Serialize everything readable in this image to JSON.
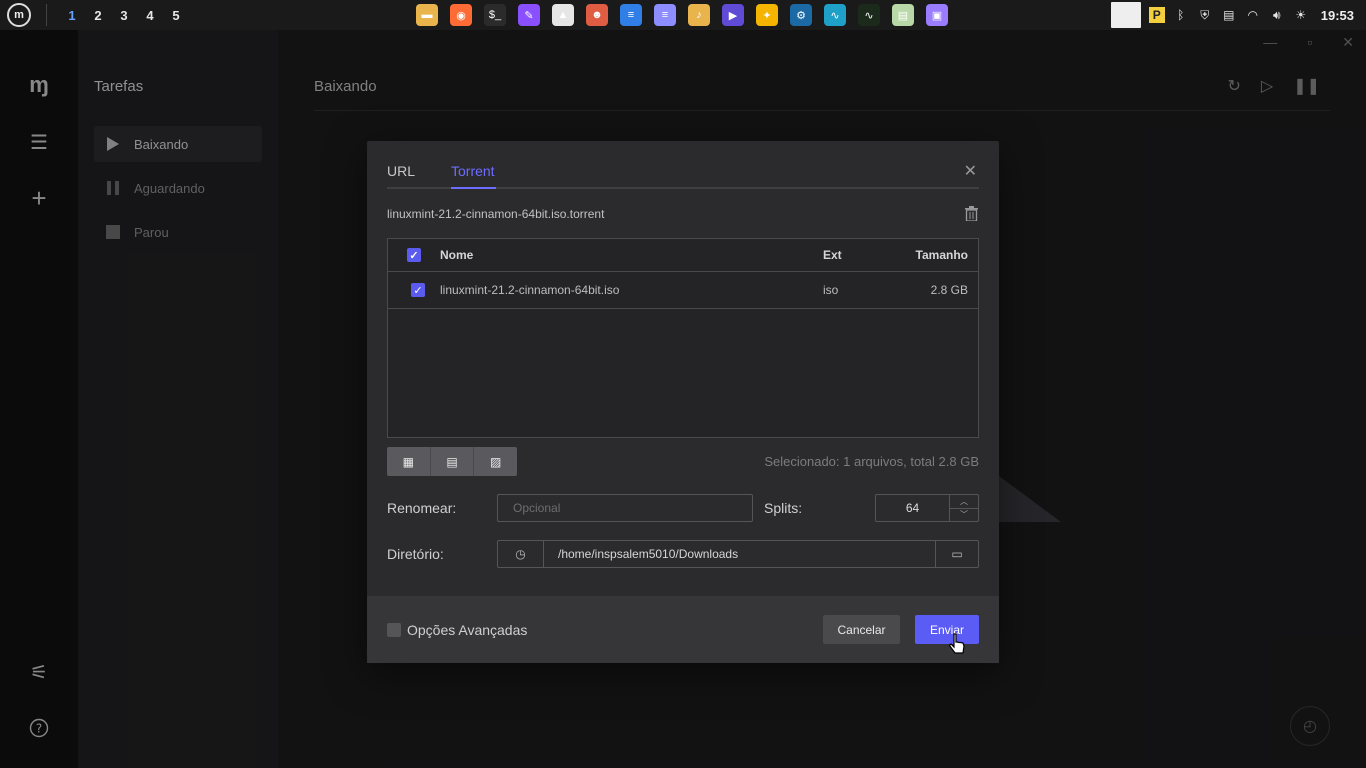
{
  "panel": {
    "workspaces": [
      "1",
      "2",
      "3",
      "4",
      "5"
    ],
    "active_workspace": "1",
    "clock": "19:53",
    "launchers": [
      {
        "name": "files",
        "glyph": "▬",
        "color": "#e9b44c"
      },
      {
        "name": "firefox",
        "glyph": "◉",
        "color": "#ff6b35"
      },
      {
        "name": "terminal",
        "glyph": "$_",
        "color": "#2b2b2b"
      },
      {
        "name": "paint",
        "glyph": "✎",
        "color": "#8a4fff"
      },
      {
        "name": "inkscape",
        "glyph": "▲",
        "color": "#e6e6e6"
      },
      {
        "name": "gimp",
        "glyph": "☻",
        "color": "#e05d44"
      },
      {
        "name": "writer",
        "glyph": "≡",
        "color": "#2f7fe6"
      },
      {
        "name": "text-editor",
        "glyph": "≡",
        "color": "#8d8dff"
      },
      {
        "name": "music-folder",
        "glyph": "♪",
        "color": "#e9b44c"
      },
      {
        "name": "media-player",
        "glyph": "▶",
        "color": "#5f4bd6"
      },
      {
        "name": "game",
        "glyph": "✦",
        "color": "#f5b400"
      },
      {
        "name": "steam",
        "glyph": "⚙",
        "color": "#1b6aa6"
      },
      {
        "name": "monitor",
        "glyph": "∿",
        "color": "#1fa0c9"
      },
      {
        "name": "system-monitor",
        "glyph": "∿",
        "color": "#1c2a1c"
      },
      {
        "name": "settings",
        "glyph": "▤",
        "color": "#b8d8a8"
      },
      {
        "name": "drive",
        "glyph": "▣",
        "color": "#9a7cff"
      }
    ]
  },
  "sidebar": {
    "title": "Tarefas",
    "items": [
      {
        "label": "Baixando",
        "active": true
      },
      {
        "label": "Aguardando",
        "active": false
      },
      {
        "label": "Parou",
        "active": false
      }
    ]
  },
  "main": {
    "title": "Baixando"
  },
  "dialog": {
    "tabs": [
      {
        "label": "URL",
        "active": false
      },
      {
        "label": "Torrent",
        "active": true
      }
    ],
    "torrent_file": "linuxmint-21.2-cinnamon-64bit.iso.torrent",
    "table": {
      "headers": {
        "name": "Nome",
        "ext": "Ext",
        "size": "Tamanho"
      },
      "rows": [
        {
          "name": "linuxmint-21.2-cinnamon-64bit.iso",
          "ext": "iso",
          "size": "2.8 GB",
          "checked": true
        }
      ]
    },
    "selection_summary": "Selecionado: 1 arquivos, total 2.8 GB",
    "rename": {
      "label": "Renomear:",
      "placeholder": "Opcional",
      "value": ""
    },
    "splits": {
      "label": "Splits:",
      "value": "64"
    },
    "directory": {
      "label": "Diretório:",
      "value": "/home/inspsalem5010/Downloads"
    },
    "advanced_label": "Opções Avançadas",
    "cancel_label": "Cancelar",
    "send_label": "Enviar"
  },
  "colors": {
    "accent": "#5b5bf5",
    "active_tab": "#6c6cff"
  }
}
